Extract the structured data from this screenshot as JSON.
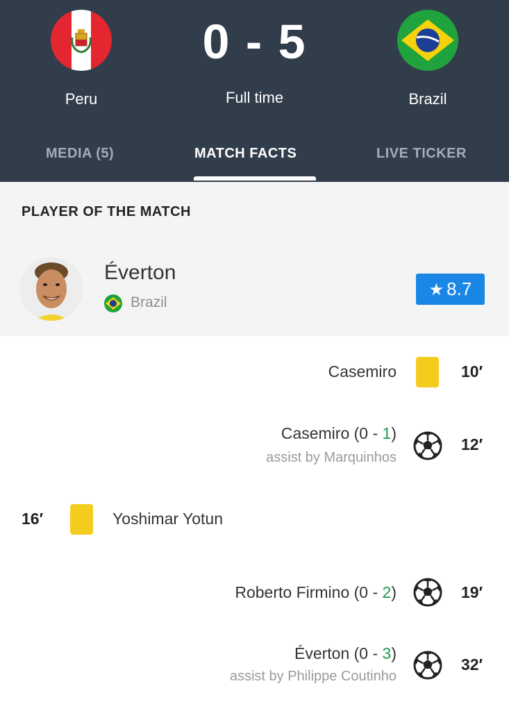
{
  "match": {
    "home_team": "Peru",
    "away_team": "Brazil",
    "score": "0 - 5",
    "status": "Full time"
  },
  "tabs": [
    {
      "label": "MEDIA (5)",
      "active": false
    },
    {
      "label": "MATCH FACTS",
      "active": true
    },
    {
      "label": "LIVE TICKER",
      "active": false
    }
  ],
  "potm": {
    "title": "PLAYER OF THE MATCH",
    "player": "Éverton",
    "team": "Brazil",
    "rating": "8.7"
  },
  "events": [
    {
      "type": "yellow-card",
      "side": "away",
      "player": "Casemiro",
      "minute": "10′"
    },
    {
      "type": "goal",
      "side": "away",
      "player": "Casemiro",
      "score_prefix": " (0 - ",
      "score_new": "1",
      "score_suffix": ")",
      "assist": "assist by Marquinhos",
      "minute": "12′"
    },
    {
      "type": "yellow-card",
      "side": "home",
      "player": "Yoshimar Yotun",
      "minute": "16′"
    },
    {
      "type": "goal",
      "side": "away",
      "player": "Roberto Firmino",
      "score_prefix": " (0 - ",
      "score_new": "2",
      "score_suffix": ")",
      "minute": "19′"
    },
    {
      "type": "goal",
      "side": "away",
      "player": "Éverton",
      "score_prefix": " (0 - ",
      "score_new": "3",
      "score_suffix": ")",
      "assist": "assist by Philippe Coutinho",
      "minute": "32′"
    }
  ],
  "colors": {
    "header_bg": "#323d4c",
    "rating_bg": "#1a87e6",
    "yellow_card": "#f4cc1e",
    "score_highlight": "#1b9a55"
  },
  "icons": [
    "peru-flag-icon",
    "brazil-flag-icon",
    "star-icon",
    "yellow-card-icon",
    "football-icon"
  ]
}
